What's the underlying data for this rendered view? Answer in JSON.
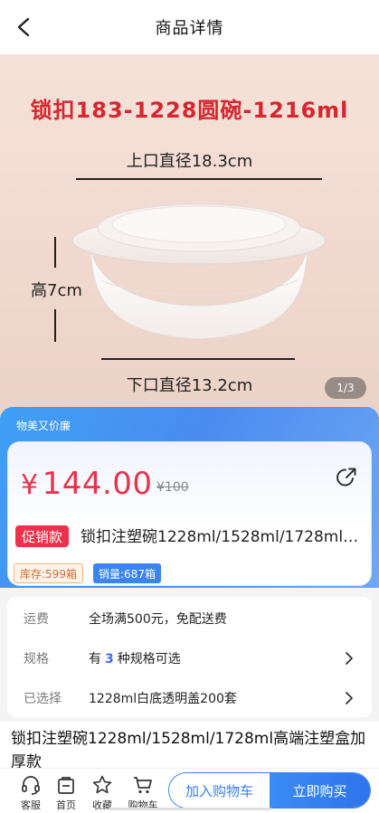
{
  "header": {
    "title": "商品详情"
  },
  "hero": {
    "title": "锁扣183-1228圆碗-1216ml",
    "dim_top": "上口直径18.3cm",
    "dim_height": "高7cm",
    "dim_bottom": "下口直径13.2cm",
    "pager": "1/3"
  },
  "promo": {
    "banner": "物美又价廉",
    "currency": "¥",
    "price": "144.00",
    "old_price": "¥100",
    "tag": "促销款",
    "name": "锁扣注塑碗1228ml/1528ml/1728ml高端注塑盒加厚款",
    "stock": "库存:599箱",
    "sales": "销量:687箱"
  },
  "info": {
    "shipping_label": "运费",
    "shipping_value": "全场满500元，免配送费",
    "spec_label": "规格",
    "spec_prefix": "有",
    "spec_count": "3",
    "spec_suffix": "种规格可选",
    "selected_label": "已选择",
    "selected_value": "1228ml白底透明盖200套"
  },
  "product": {
    "full_title": "锁扣注塑碗1228ml/1528ml/1728ml高端注塑盒加厚款"
  },
  "bottombar": {
    "service": "客服",
    "home": "首页",
    "favorite": "收藏",
    "cart": "购物车",
    "add_to_cart": "加入购物车",
    "buy_now": "立即购买"
  },
  "colors": {
    "accent": "#3a7ff2",
    "price_red": "#e8334a",
    "hero_text_red": "#d6272f"
  }
}
